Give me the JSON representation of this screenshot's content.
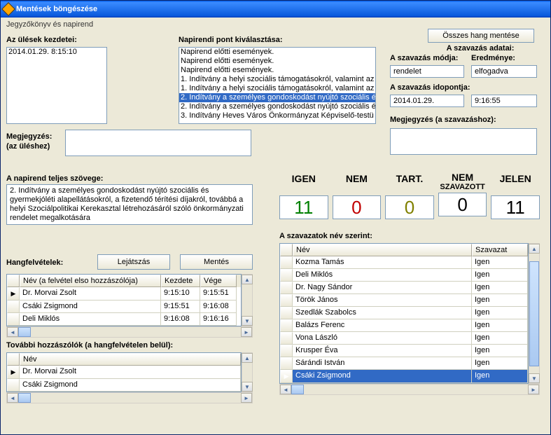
{
  "window": {
    "title": "Mentések böngészése",
    "subtitle": "Jegyzőkönyv és napirend"
  },
  "labels": {
    "sessions": "Az ülések kezdetei:",
    "agenda_select": "Napirendi pont kiválasztása:",
    "save_all_audio": "Összes hang mentése",
    "vote_data": "A szavazás adatai:",
    "vote_mode": "A szavazás módja:",
    "vote_result": "Eredménye:",
    "vote_time": "A szavazás idopontja:",
    "vote_note": "Megjegyzés (a szavazáshoz):",
    "note": "Megjegyzés:",
    "note2": "(az üléshez)",
    "agenda_full": "A napirend teljes szövege:",
    "recordings": "Hangfelvételek:",
    "play": "Lejátszás",
    "save": "Mentés",
    "more_speakers": "További hozzászólók (a hangfelvételen belül):",
    "votes_by_name": "A szavazatok név szerint:",
    "col_name_rec": "Név (a felvétel elso hozzászólója)",
    "col_start": "Kezdete",
    "col_end": "Vége",
    "col_name": "Név",
    "col_vote": "Szavazat"
  },
  "session": {
    "value": "2014.01.29.   8:15:10"
  },
  "agenda_items": [
    "Napirend előtti események.",
    "Napirend előtti események.",
    "Napirend előtti események.",
    "1. Indítvány a helyi szociális támogatásokról, valamint az",
    "1. Indítvány a helyi szociális támogatásokról, valamint az",
    "2. Indítvány a személyes gondoskodást nyújtó szociális é",
    "2. Indítvány a személyes gondoskodást nyújtó szociális é",
    "3. Indítvány Heves Város Önkormányzat Képviselő-testü"
  ],
  "agenda_selected_index": 5,
  "vote": {
    "mode": "rendelet",
    "result": "elfogadva",
    "date": "2014.01.29.",
    "time": "9:16:55"
  },
  "agenda_full_text": "2. Indítvány a személyes gondoskodást nyújtó szociális és gyermekjóléti alapellátásokról, a fizetendő térítési díjakról, továbbá a helyi Szociálpolitikai Kerekasztal létrehozásáról szóló önkormányzati rendelet megalkotására",
  "vote_counts": {
    "igen": {
      "label": "IGEN",
      "value": "11",
      "color": "#008000"
    },
    "nem": {
      "label": "NEM",
      "value": "0",
      "color": "#C00000"
    },
    "tart": {
      "label": "TART.",
      "value": "0",
      "color": "#808000"
    },
    "nemsz": {
      "label": "NEM",
      "label2": "SZAVAZOTT",
      "value": "0",
      "color": "#000"
    },
    "jelen": {
      "label": "JELEN",
      "value": "11",
      "color": "#000"
    }
  },
  "recordings": [
    {
      "name": "Dr. Morvai Zsolt",
      "start": "9:15:10",
      "end": "9:15:51"
    },
    {
      "name": "Csáki Zsigmond",
      "start": "9:15:51",
      "end": "9:16:08"
    },
    {
      "name": "Deli Miklós",
      "start": "9:16:08",
      "end": "9:16:16"
    }
  ],
  "recordings_selected": 0,
  "speakers": [
    {
      "name": "Dr. Morvai Zsolt"
    },
    {
      "name": "Csáki Zsigmond"
    }
  ],
  "speakers_selected": 0,
  "votes": [
    {
      "name": "Kozma Tamás",
      "vote": "Igen"
    },
    {
      "name": "Deli Miklós",
      "vote": "Igen"
    },
    {
      "name": "Dr. Nagy Sándor",
      "vote": "Igen"
    },
    {
      "name": "Török János",
      "vote": "Igen"
    },
    {
      "name": "Szedlák Szabolcs",
      "vote": "Igen"
    },
    {
      "name": "Balázs Ferenc",
      "vote": "Igen"
    },
    {
      "name": "Vona László",
      "vote": "Igen"
    },
    {
      "name": "Krusper Éva",
      "vote": "Igen"
    },
    {
      "name": "Sárándi István",
      "vote": "Igen"
    },
    {
      "name": "Csáki Zsigmond",
      "vote": "Igen"
    }
  ],
  "votes_selected": 9,
  "chart_data": {
    "type": "table",
    "title": "Vote counts",
    "categories": [
      "IGEN",
      "NEM",
      "TART.",
      "NEM SZAVAZOTT",
      "JELEN"
    ],
    "values": [
      11,
      0,
      0,
      0,
      11
    ]
  }
}
